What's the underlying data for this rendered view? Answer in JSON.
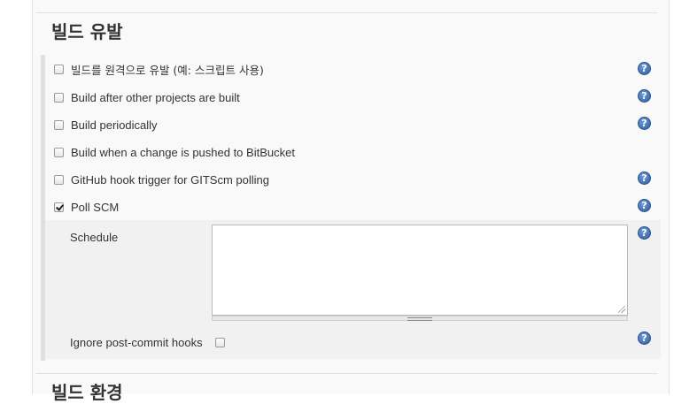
{
  "section": {
    "title": "빌드 유발"
  },
  "triggers": [
    {
      "label": "빌드를 원격으로 유발 (예: 스크립트 사용)",
      "checked": false,
      "help": true
    },
    {
      "label": "Build after other projects are built",
      "checked": false,
      "help": true
    },
    {
      "label": "Build periodically",
      "checked": false,
      "help": true
    },
    {
      "label": "Build when a change is pushed to BitBucket",
      "checked": false,
      "help": false
    },
    {
      "label": "GitHub hook trigger for GITScm polling",
      "checked": false,
      "help": true
    },
    {
      "label": "Poll SCM",
      "checked": true,
      "help": true
    }
  ],
  "poll_scm": {
    "schedule_label": "Schedule",
    "schedule_value": "",
    "ignore_label": "Ignore post-commit hooks",
    "ignore_checked": false
  },
  "help_glyph": "?",
  "next_section": {
    "title": "빌드 환경"
  }
}
